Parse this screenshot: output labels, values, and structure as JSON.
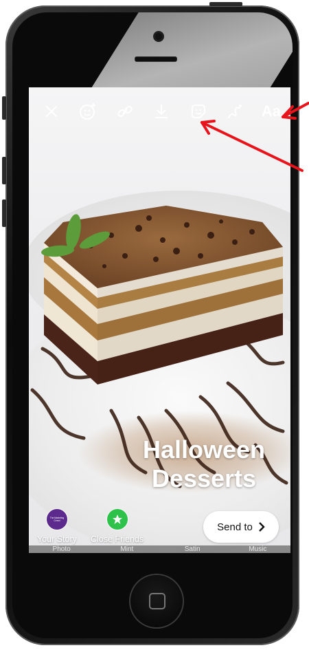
{
  "toolbar": {
    "text_tool_label": "Aa"
  },
  "story": {
    "caption_line1": "Halloween",
    "caption_line2": "Desserts"
  },
  "share": {
    "your_story_label": "Your Story",
    "your_story_avatar_text": "The Marketing Crowd",
    "close_friends_label": "Close Friends",
    "send_button_label": "Send to"
  },
  "filters": [
    "Photo",
    "Mint",
    "Satin",
    "Music"
  ],
  "colors": {
    "close_friends_green": "#2ec24a",
    "your_story_purple": "#5b2a8c",
    "annotation_red": "#e8141c"
  },
  "icons": [
    "close-icon",
    "face-effects-icon",
    "link-icon",
    "download-icon",
    "sticker-icon",
    "draw-icon",
    "chevron-right-icon",
    "star-icon"
  ]
}
